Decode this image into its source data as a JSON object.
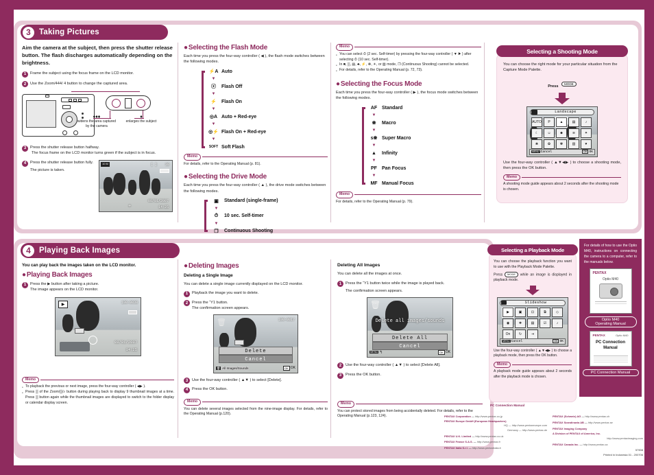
{
  "doc": {
    "brand": "PENTAX",
    "model": "Optio M40",
    "accent": "#8e2b5e",
    "panel_bg": "#fbe9f0"
  },
  "section3": {
    "number": "3",
    "title": "Taking Pictures",
    "lead": "Aim the camera at the subject, then press the shutter release button. The flash discharges automatically depending on the brightness.",
    "steps": [
      {
        "n": "1",
        "text": "Frame the subject using the focus frame on the LCD monitor."
      },
      {
        "n": "2",
        "text": "Use the Zoom/444/ 4 button to change the captured area."
      },
      {
        "n": "3",
        "text": "Press the shutter release button halfway.",
        "sub": "The focus frame on the LCD monitor turns green if the subject is in focus."
      },
      {
        "n": "4",
        "text": "Press the shutter release button fully.",
        "sub": "The picture is taken."
      }
    ],
    "zoom_labels": {
      "wide_icon": "♦♦♦",
      "wide": "widens the area captured by the camera",
      "tele_icon": "♦",
      "tele": "enlarges the subject"
    },
    "lcd_preview": {
      "quality": "10 M",
      "remaining": "38",
      "date": "08/01/2007",
      "time": "14:25"
    },
    "flash": {
      "title": "Selecting the Flash Mode",
      "intro": "Each time you press the four-way controller ( ◀ ), the flash mode switches between the following modes.",
      "modes": [
        {
          "icon": "⚡A",
          "label": "Auto"
        },
        {
          "icon": "ⓧ",
          "label": "Flash Off"
        },
        {
          "icon": "⚡",
          "label": "Flash On"
        },
        {
          "icon": "◎A",
          "label": "Auto + Red-eye"
        },
        {
          "icon": "◎⚡",
          "label": "Flash On + Red-eye"
        },
        {
          "icon": "SOFT",
          "label": "Soft Flash"
        }
      ],
      "memo": "For details, refer to the Operating Manual (p. 81)."
    },
    "drive": {
      "title": "Selecting the Drive Mode",
      "intro": "Each time you press the four-way controller ( ▲ ), the drive mode switches between the following modes.",
      "modes": [
        {
          "icon": "▣",
          "label": "Standard (single-frame)"
        },
        {
          "icon": "⏱",
          "label": "10 sec. Self-timer"
        },
        {
          "icon": "❐",
          "label": "Continuous Shooting"
        }
      ]
    },
    "drive_memo": {
      "label": "Memo",
      "items": [
        "You can select ⏱ (2 sec. Self-timer) by pressing the four-way controller ( ▼ ▶ ) after selecting ⏱ (10 sec. Self-timer).",
        "In ■, ▒, ▤, ♣, ⚡, ☸, ☀, or ▧ mode, ❐ (Continuous Shooting) cannot be selected.",
        "For details, refer to the Operating Manual (p. 72, 73)."
      ]
    },
    "focus": {
      "title": "Selecting the Focus Mode",
      "intro": "Each time you press the four-way controller ( ▶ ), the focus mode switches between the following modes.",
      "modes": [
        {
          "icon": "AF",
          "label": "Standard"
        },
        {
          "icon": "❀",
          "label": "Macro"
        },
        {
          "icon": "s❀",
          "label": "Super Macro"
        },
        {
          "icon": "▲",
          "label": "Infinity"
        },
        {
          "icon": "PF",
          "label": "Pan Focus"
        },
        {
          "icon": "MF",
          "label": "Manual Focus"
        }
      ],
      "memo": "For details, refer to the Operating Manual (p. 79)."
    },
    "shooting_panel": {
      "title": "Selecting a Shooting Mode",
      "intro": "You can choose the right mode for your particular situation from the Capture Mode Palette.",
      "press_label": "Press",
      "press_button": "MODE",
      "lcd_title": "Landscape",
      "lcd_cancel": "Cancel",
      "lcd_menu": "MENU",
      "lcd_ok": "OK",
      "lcd_ok_label": "OK",
      "caption": "Use the four-way controller ( ▲▼◀▶ ) to choose a shooting mode, then press the OK button.",
      "memo_label": "Memo",
      "memo": "A shooting mode guide appears about 2 seconds after the shooting mode is chosen."
    }
  },
  "section4": {
    "number": "4",
    "title": "Playing Back Images",
    "lead": "You can play back the images taken on the LCD monitor.",
    "playback": {
      "title": "Playing Back Images",
      "steps": [
        {
          "n": "1",
          "text": "Press the ▶ button after taking a picture.",
          "sub": "The image appears on the LCD monitor."
        }
      ],
      "lcd": {
        "file": "100-0038",
        "date": "08/01/2007",
        "time": "14:25"
      },
      "memo_label": "Memo",
      "memo_items": [
        "To playback the previous or next image, press the four-way controller ( ◀▶ ).",
        "Press ▒ of the Zoom/▒/⌕ button during playing back to display 9 thumbnail images at a time. Press ▒ button again while the thumbnail images are displayed to switch to the folder display or calendar display screen."
      ]
    },
    "deleting": {
      "title": "Deleting Images",
      "single_heading": "Deleting a Single Image",
      "single_intro": "You can delete a single image currently displayed on the LCD monitor.",
      "steps": [
        {
          "n": "1",
          "text": "Playback the image you want to delete."
        },
        {
          "n": "2",
          "text": "Press the Ὕ1 button.",
          "sub": "The confirmation screen appears."
        },
        {
          "n": "3",
          "text": "Use the four-way controller ( ▲▼ ) to select [Delete]."
        },
        {
          "n": "4",
          "text": "Press the OK button."
        }
      ],
      "lcd": {
        "file": "100-0017",
        "opt1": "Delete",
        "opt2": "Cancel",
        "bottom_left": "All Images/Sounds",
        "ok": "OK",
        "ok_label": "OK"
      },
      "memo_label": "Memo",
      "memo": "You can delete several images selected from the nine-image display. For details, refer to the Operating Manual (p.120)."
    },
    "delete_all": {
      "heading": "Deleting All Images",
      "intro": "You can delete all the images at once.",
      "steps": [
        {
          "n": "1",
          "text": "Press the Ὕ1 button twice while the image is played back.",
          "sub": "The confirmation screen appears."
        },
        {
          "n": "2",
          "text": "Use the four-way controller ( ▲▼ ) to select [Delete All]."
        },
        {
          "n": "3",
          "text": "Press the OK button."
        }
      ],
      "lcd": {
        "overlay": "Delete all images/sounds",
        "opt1": "Delete All",
        "opt2": "Cancel",
        "menu": "MENU",
        "ok": "OK",
        "ok_label": "OK"
      },
      "memo_label": "Memo",
      "memo": "You can protect stored images from being accidentally deleted. For details, refer to the Operating Manual (p.123, 124)."
    },
    "playback_panel": {
      "title": "Selecting a Playback Mode",
      "intro": "You can choose the playback function you want to use with the Playback Mode Palette.",
      "press_prefix": "Press",
      "press_button": "MODE",
      "press_suffix": "while an image is displayed in playback mode.",
      "lcd_title": "Slideshow",
      "lcd_cancel": "Cancel",
      "lcd_menu": "MENU",
      "lcd_ok": "OK",
      "lcd_ok_label": "OK",
      "caption": "Use the four-way controller ( ▲▼◀▶ ) to choose a playback mode, then press the OK button.",
      "memo_label": "Memo",
      "memo": "A playback mode guide appears about 2 seconds after the playback mode is chosen."
    }
  },
  "manuals": {
    "intro": "For details of how to use the Optio M40, instructions on connecting the camera to a computer, refer to the manuals below.",
    "items": [
      {
        "brand": "PENTAX",
        "model": "Optio M40",
        "sub": "Operating Manual",
        "caption": "Optio M40\nOperating Manual"
      },
      {
        "brand": "PENTAX",
        "model": "Optio M40",
        "sub": "PC Connection Manual",
        "caption": "PC Connection Manual"
      }
    ],
    "sidebar_label_top": "PC Connection Manual"
  },
  "footer": {
    "left_column": [
      {
        "name": "PENTAX Corporation",
        "url": "http://www.pentax.co.jp"
      },
      {
        "name": "PENTAX Europe GmbH (European Headquarters)",
        "url": "HQ — http://www.pentaxeurope.com"
      },
      {
        "name": "",
        "url": "Germany — http://www.pentax.de"
      },
      {
        "name": "PENTAX U.K. Limited",
        "url": "http://www.pentax.co.uk"
      },
      {
        "name": "PENTAX France S.A.S.",
        "url": "http://www.pentax.fr"
      },
      {
        "name": "PENTAX Italia S.r.l.",
        "url": "http://www.pentaxitalia.it"
      }
    ],
    "right_column": [
      {
        "name": "PENTAX (Schweiz) AG",
        "url": "http://www.pentax.ch"
      },
      {
        "name": "PENTAX Scandinavia AB",
        "url": "http://www.pentax.se"
      },
      {
        "name": "PENTAX Imaging Company",
        "url": ""
      },
      {
        "name": "A Division of PENTAX of America, Inc.",
        "url": "http://www.pentaximaging.com"
      },
      {
        "name": "PENTAX Canada Inc.",
        "url": "http://www.pentax.ca"
      }
    ],
    "code": "57908",
    "print": "Printed in Indonesia 01 - 200706",
    "side_label": "PC Connection Manual"
  }
}
